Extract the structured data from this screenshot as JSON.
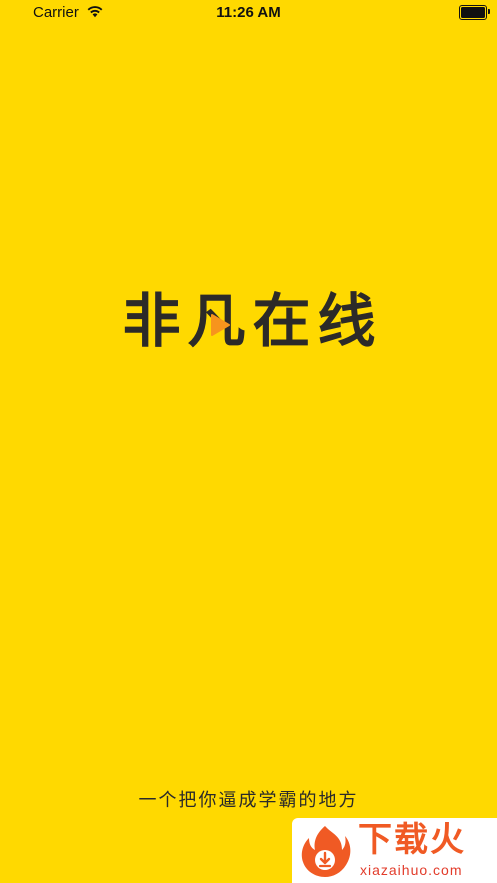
{
  "status_bar": {
    "carrier": "Carrier",
    "time": "11:26 AM",
    "wifi_icon": "wifi-icon",
    "battery_icon": "battery-icon",
    "battery_level": 1.0
  },
  "logo": {
    "chars": [
      "非",
      "凡",
      "在",
      "线"
    ],
    "play_icon": "play-icon",
    "text_color": "#2C2A28",
    "accent_color": "#F7941D"
  },
  "slogan": "一个把你逼成学霸的地方",
  "watermark": {
    "title": "下载火",
    "subtitle": "xiazaihuo.com",
    "icon": "flame-logo-icon",
    "color": "#F05A24"
  },
  "colors": {
    "background": "#FFD900"
  }
}
